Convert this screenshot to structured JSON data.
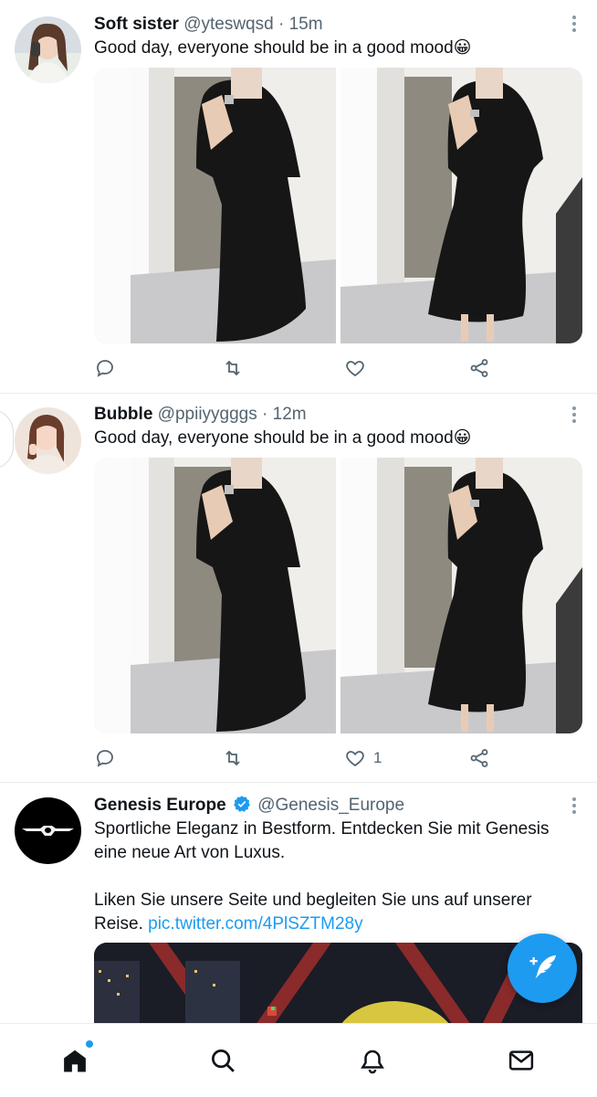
{
  "tweets": [
    {
      "name": "Soft sister",
      "handle": "@yteswqsd",
      "dot": "·",
      "time": "15m",
      "text": "Good day, everyone should be in a good mood😀",
      "likes": "",
      "icons": [
        "reply-icon",
        "retweet-icon",
        "like-icon",
        "share-icon"
      ]
    },
    {
      "name": "Bubble",
      "handle": "@ppiiyygggs",
      "dot": "·",
      "time": "12m",
      "text": "Good day, everyone should be in a good mood😀",
      "likes": "1",
      "icons": [
        "reply-icon",
        "retweet-icon",
        "like-icon",
        "share-icon"
      ]
    }
  ],
  "promo": {
    "name": "Genesis Europe",
    "handle": "@Genesis_Europe",
    "text1": "Sportliche Eleganz in Bestform. Entdecken Sie mit Genesis eine neue Art von Luxus.",
    "text2": "Liken Sie unsere Seite und begleiten Sie uns auf unserer Reise.",
    "link": "pic.twitter.com/4PlSZTM28y"
  },
  "nav": {
    "items": [
      "home-icon",
      "search-icon",
      "notifications-icon",
      "messages-icon"
    ]
  },
  "colors": {
    "accent": "#1d9bf0",
    "text": "#0f1419",
    "muted": "#536471"
  }
}
